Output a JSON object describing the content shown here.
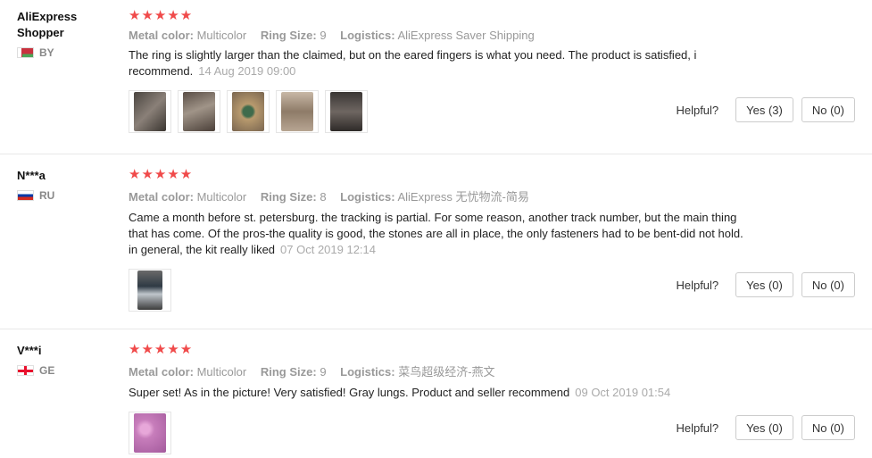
{
  "reviews": [
    {
      "user": "AliExpress Shopper",
      "country": "BY",
      "flag": "flag-belarus",
      "stars": "★★★★★",
      "metal_label": "Metal color:",
      "metal": "Multicolor",
      "size_label": "Ring Size:",
      "size": "9",
      "logistics_label": "Logistics:",
      "logistics": "AliExpress Saver Shipping",
      "text": "The ring is slightly larger than the claimed, but on the eared fingers is what you need. The product is satisfied, i recommend.",
      "date": "14 Aug 2019 09:00",
      "helpful_label": "Helpful?",
      "yes": "Yes (3)",
      "no": "No (0)"
    },
    {
      "user": "N***a",
      "country": "RU",
      "flag": "flag-russia",
      "stars": "★★★★★",
      "metal_label": "Metal color:",
      "metal": "Multicolor",
      "size_label": "Ring Size:",
      "size": "8",
      "logistics_label": "Logistics:",
      "logistics": "AliExpress 无忧物流-简易",
      "text": "Came a month before st. petersburg. the tracking is partial. For some reason, another track number, but the main thing that has come. Of the pros-the quality is good, the stones are all in place, the only fasteners had to be bent-did not hold. in general, the kit really liked",
      "date": "07 Oct 2019 12:14",
      "helpful_label": "Helpful?",
      "yes": "Yes (0)",
      "no": "No (0)"
    },
    {
      "user": "V***i",
      "country": "GE",
      "flag": "flag-georgia",
      "stars": "★★★★★",
      "metal_label": "Metal color:",
      "metal": "Multicolor",
      "size_label": "Ring Size:",
      "size": "9",
      "logistics_label": "Logistics:",
      "logistics": "菜鸟超级经济-燕文",
      "text": "Super set! As in the picture! Very satisfied! Gray lungs. Product and seller recommend",
      "date": "09 Oct 2019 01:54",
      "helpful_label": "Helpful?",
      "yes": "Yes (0)",
      "no": "No (0)"
    }
  ]
}
